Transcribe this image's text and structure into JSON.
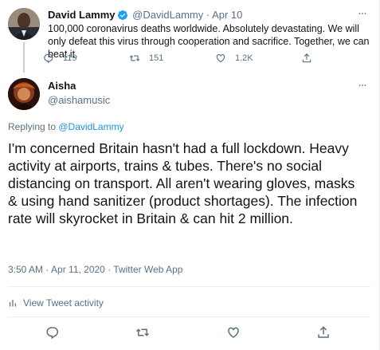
{
  "parent": {
    "name": "David Lammy",
    "handle": "@DavidLammy",
    "date": "· Apr 10",
    "text": "100,000 coronavirus deaths worldwide. Absolutely devastating. We will only defeat this virus through cooperation and sacrifice. Together, we can beat it.",
    "replies": "119",
    "retweets": "151",
    "likes": "1.2K"
  },
  "tweet": {
    "name": "Aisha",
    "handle": "@aishamusic",
    "replying_prefix": "Replying to ",
    "replying_to": "@DavidLammy",
    "text": "I'm concerned Britain hasn't had a full lockdown. Heavy activity at airports, trains & tubes. There's no social distancing on transport. All aren't wearing gloves, masks & using hand sanitizer (product shortages). The infection rate will skyrocket in Britain & can hit 2 million.",
    "timestamp": "3:50 AM · Apr 11, 2020 · Twitter Web App",
    "activity_label": "View Tweet activity"
  },
  "icons": {
    "reply": "reply-icon",
    "retweet": "retweet-icon",
    "like": "heart-icon",
    "share": "share-icon",
    "more": "more-icon",
    "verified": "verified-badge-icon",
    "activity": "bar-chart-icon"
  },
  "colors": {
    "link": "#1b95e0",
    "verified": "#1da1f2",
    "secondary_text": "#5b7083"
  }
}
